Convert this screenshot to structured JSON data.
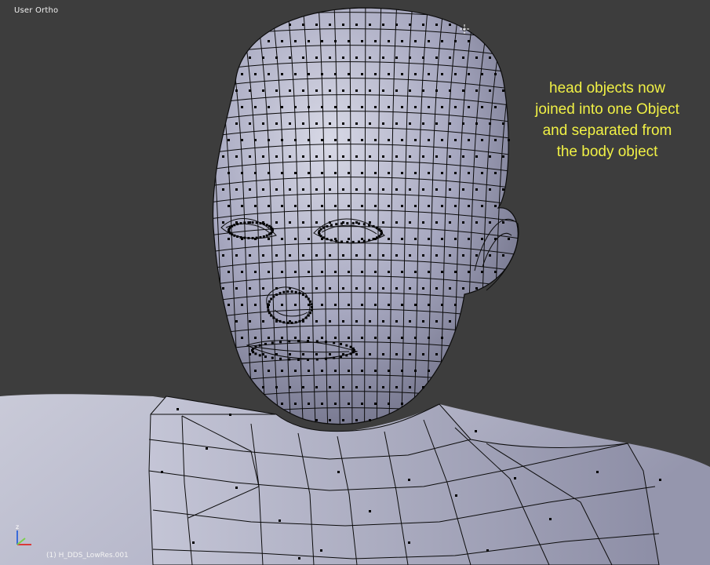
{
  "viewport": {
    "view_label": "User Ortho",
    "object_name": "(1) H_DDS_LowRes.001"
  },
  "annotation": {
    "lines": [
      "head objects now",
      "joined into one Object",
      "and separated from",
      "the body object"
    ],
    "color": "#f0f045"
  },
  "colors": {
    "background": "#3d3d3d",
    "mesh_fill": "#a9aac2",
    "wire": "#0b0b0b",
    "vertex": "#000000",
    "axis_x": "#d93a3a",
    "axis_y": "#7ad04a",
    "axis_z": "#3a6bd9"
  },
  "gizmo": {
    "axis_label": "z"
  }
}
